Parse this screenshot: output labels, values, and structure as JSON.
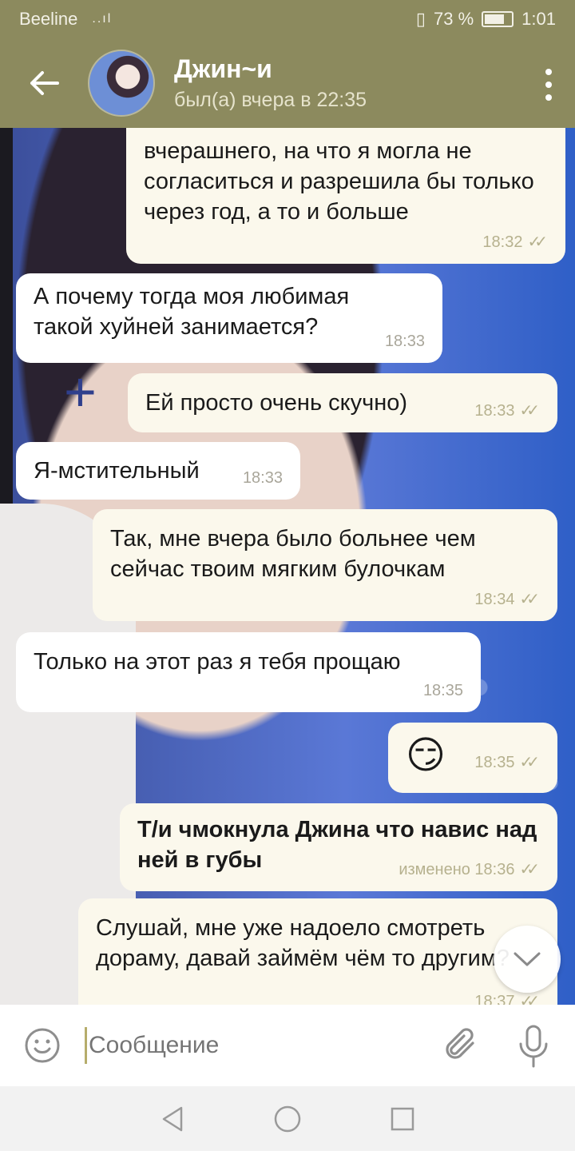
{
  "status_bar": {
    "carrier": "Beeline",
    "signal": "..ıl",
    "battery_percent": "73 %",
    "battery_level": 0.73,
    "time": "1:01"
  },
  "header": {
    "title": "Джин~и",
    "subtitle": "был(а) вчера в 22:35"
  },
  "messages": [
    {
      "dir": "out",
      "text": "вчерашнего, на что я могла не согласиться и разрешила бы только через год, а то и больше",
      "time": "18:32",
      "read": true
    },
    {
      "dir": "in",
      "text": "А почему тогда моя любимая такой хуйней занимается?",
      "time": "18:33"
    },
    {
      "dir": "out",
      "text": "Ей просто очень скучно)",
      "time": "18:33",
      "read": true
    },
    {
      "dir": "in",
      "text": "Я-мстительный",
      "time": "18:33"
    },
    {
      "dir": "out",
      "text": "Так, мне вчера было больнее чем сейчас твоим мягким булочкам",
      "time": "18:34",
      "read": true
    },
    {
      "dir": "in",
      "text": "Только на этот раз я тебя прощаю",
      "time": "18:35"
    },
    {
      "dir": "out",
      "text": "😏",
      "time": "18:35",
      "read": true
    },
    {
      "dir": "out",
      "text": "Т/и чмокнула Джина что навис над ней в губы",
      "time": "изменено 18:36",
      "read": true,
      "bold": true
    },
    {
      "dir": "in",
      "text": "Слушай, мне уже надоело смотреть дораму, давай займём чём то другим?",
      "time": "18:37"
    }
  ],
  "input": {
    "placeholder": "Сообщение"
  },
  "icons": {
    "back": "arrow-left-icon",
    "more": "more-vertical-icon",
    "emoji": "smile-icon",
    "attach": "paperclip-icon",
    "mic": "microphone-icon",
    "scroll": "chevron-down-icon"
  },
  "colors": {
    "header_bg": "#8c8a5e",
    "outgoing_bubble": "#fbf8ec",
    "incoming_bubble": "#ffffff",
    "check_color": "#b6b18e"
  }
}
